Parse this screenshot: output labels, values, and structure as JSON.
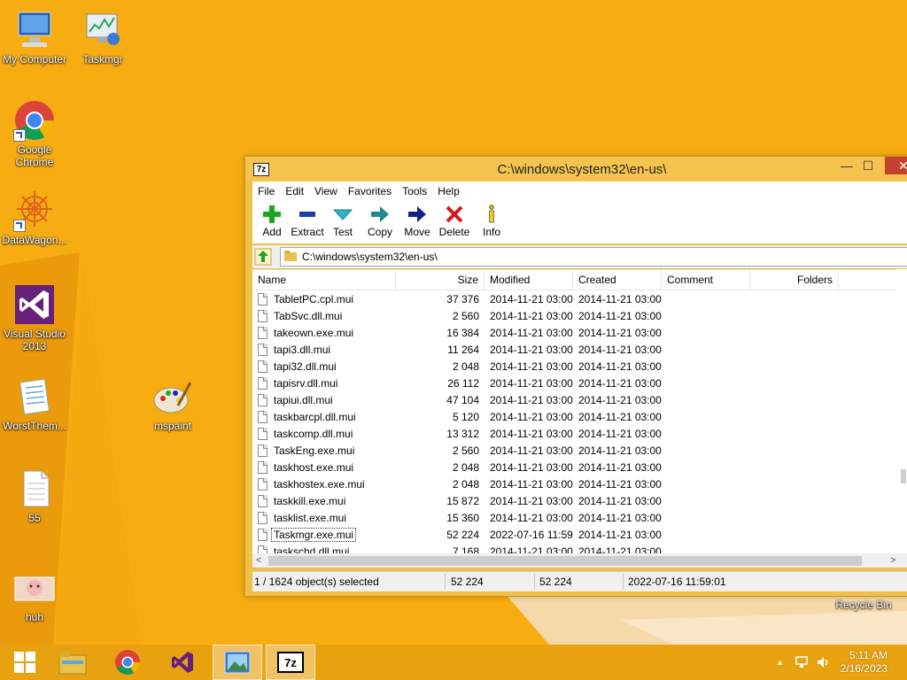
{
  "desktop": {
    "icons": [
      {
        "label": "My Computer"
      },
      {
        "label": "Taskmgr"
      },
      {
        "label": "Google Chrome"
      },
      {
        "label": "DataWagon..."
      },
      {
        "label": "Visual Studio 2013"
      },
      {
        "label": "WorstThem..."
      },
      {
        "label": "mspaint"
      },
      {
        "label": "55"
      },
      {
        "label": "huh"
      },
      {
        "label": "Recycle Bin"
      }
    ]
  },
  "window": {
    "title": "C:\\windows\\system32\\en-us\\",
    "app_icon_text": "7z",
    "controls": {
      "minimize": "—",
      "maximize": "☐",
      "close": "✕"
    },
    "menu": [
      "File",
      "Edit",
      "View",
      "Favorites",
      "Tools",
      "Help"
    ],
    "toolbar": [
      {
        "label": "Add",
        "icon": "add-icon",
        "color": "#1ea51e"
      },
      {
        "label": "Extract",
        "icon": "extract-icon",
        "color": "#1d3fae"
      },
      {
        "label": "Test",
        "icon": "test-icon",
        "color": "#2fb6c9"
      },
      {
        "label": "Copy",
        "icon": "copy-icon",
        "color": "#1e8a8f"
      },
      {
        "label": "Move",
        "icon": "move-icon",
        "color": "#16248a"
      },
      {
        "label": "Delete",
        "icon": "delete-icon",
        "color": "#d21919"
      },
      {
        "label": "Info",
        "icon": "info-icon",
        "color": "#c7b20e"
      }
    ],
    "address": "C:\\windows\\system32\\en-us\\",
    "columns": [
      "Name",
      "Size",
      "Modified",
      "Created",
      "Comment",
      "Folders"
    ],
    "files": [
      {
        "name": "TabletPC.cpl.mui",
        "size": "37 376",
        "modified": "2014-11-21 03:00",
        "created": "2014-11-21 03:00"
      },
      {
        "name": "TabSvc.dll.mui",
        "size": "2 560",
        "modified": "2014-11-21 03:00",
        "created": "2014-11-21 03:00"
      },
      {
        "name": "takeown.exe.mui",
        "size": "16 384",
        "modified": "2014-11-21 03:00",
        "created": "2014-11-21 03:00"
      },
      {
        "name": "tapi3.dll.mui",
        "size": "11 264",
        "modified": "2014-11-21 03:00",
        "created": "2014-11-21 03:00"
      },
      {
        "name": "tapi32.dll.mui",
        "size": "2 048",
        "modified": "2014-11-21 03:00",
        "created": "2014-11-21 03:00"
      },
      {
        "name": "tapisrv.dll.mui",
        "size": "26 112",
        "modified": "2014-11-21 03:00",
        "created": "2014-11-21 03:00"
      },
      {
        "name": "tapiui.dll.mui",
        "size": "47 104",
        "modified": "2014-11-21 03:00",
        "created": "2014-11-21 03:00"
      },
      {
        "name": "taskbarcpl.dll.mui",
        "size": "5 120",
        "modified": "2014-11-21 03:00",
        "created": "2014-11-21 03:00"
      },
      {
        "name": "taskcomp.dll.mui",
        "size": "13 312",
        "modified": "2014-11-21 03:00",
        "created": "2014-11-21 03:00"
      },
      {
        "name": "TaskEng.exe.mui",
        "size": "2 560",
        "modified": "2014-11-21 03:00",
        "created": "2014-11-21 03:00"
      },
      {
        "name": "taskhost.exe.mui",
        "size": "2 048",
        "modified": "2014-11-21 03:00",
        "created": "2014-11-21 03:00"
      },
      {
        "name": "taskhostex.exe.mui",
        "size": "2 048",
        "modified": "2014-11-21 03:00",
        "created": "2014-11-21 03:00"
      },
      {
        "name": "taskkill.exe.mui",
        "size": "15 872",
        "modified": "2014-11-21 03:00",
        "created": "2014-11-21 03:00"
      },
      {
        "name": "tasklist.exe.mui",
        "size": "15 360",
        "modified": "2014-11-21 03:00",
        "created": "2014-11-21 03:00"
      },
      {
        "name": "Taskmgr.exe.mui",
        "size": "52 224",
        "modified": "2022-07-16 11:59",
        "created": "2014-11-21 03:00",
        "selected": true
      },
      {
        "name": "taskschd.dll.mui",
        "size": "7 168",
        "modified": "2014-11-21 03:00",
        "created": "2014-11-21 03:00"
      }
    ],
    "status": {
      "selection": "1 / 1624 object(s) selected",
      "size": "52 224",
      "packed": "52 224",
      "modified": "2022-07-16 11:59:01"
    }
  },
  "taskbar": {
    "items": [
      "start-icon",
      "file-explorer-icon",
      "chrome-icon",
      "visual-studio-icon",
      "photo-viewer-icon",
      "7zip-icon"
    ],
    "clock": {
      "time": "5:11 AM",
      "date": "2/16/2023"
    },
    "tray_arrow": "▲"
  },
  "colors": {
    "desktop": "#f5a90f",
    "taskbar": "#e8a20f",
    "close_button": "#c7412f"
  }
}
